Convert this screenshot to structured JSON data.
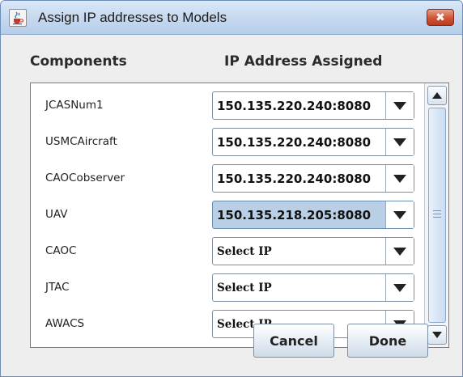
{
  "window": {
    "title": "Assign IP addresses to Models",
    "close_glyph": "✖",
    "app_icon": "java-cup-icon"
  },
  "headers": {
    "components": "Components",
    "ip_assigned": "IP Address Assigned"
  },
  "rows": [
    {
      "component": "JCASNum1",
      "ip": "150.135.220.240:8080",
      "selected": false
    },
    {
      "component": "USMCAircraft",
      "ip": "150.135.220.240:8080",
      "selected": false
    },
    {
      "component": "CAOCobserver",
      "ip": "150.135.220.240:8080",
      "selected": false
    },
    {
      "component": "UAV",
      "ip": "150.135.218.205:8080",
      "selected": true
    },
    {
      "component": "CAOC",
      "ip": "Select IP",
      "selected": false
    },
    {
      "component": "JTAC",
      "ip": "Select IP",
      "selected": false
    },
    {
      "component": "AWACS",
      "ip": "Select IP",
      "selected": false
    }
  ],
  "buttons": {
    "cancel": "Cancel",
    "done": "Done"
  },
  "colors": {
    "selected_combo": "#b8cfe5",
    "titlebar": "#c4d8ef",
    "close_button": "#d2573a"
  }
}
